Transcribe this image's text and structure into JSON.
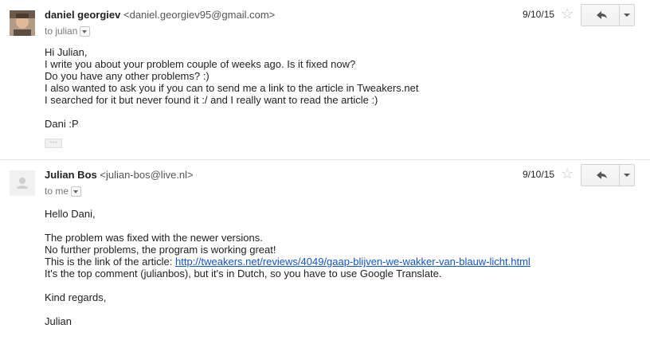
{
  "messages": [
    {
      "sender_name": "daniel georgiev",
      "sender_email": "<daniel.georgiev95@gmail.com>",
      "to_line": "to julian",
      "date": "9/10/15",
      "body": {
        "l1": "Hi Julian,",
        "l2": "I write you about your problem couple of weeks ago. Is it fixed now?",
        "l3": "Do you have any other problems? :)",
        "l4": "I also wanted to ask you if you can to send me a link to the article in Tweakers.net",
        "l5": "I searched for it but never found it :/ and I really want to read the article :)",
        "l6": "Dani :P"
      },
      "ellipsis": "···"
    },
    {
      "sender_name": "Julian Bos",
      "sender_email": "<julian-bos@live.nl>",
      "to_line": "to me",
      "date": "9/10/15",
      "body": {
        "l1": "Hello Dani,",
        "l2": "The problem was fixed with the newer versions.",
        "l3": "No further problems, the program is working great!",
        "l4_prefix": "This is the link of the article: ",
        "l4_link": "http://tweakers.net/reviews/4049/gaap-blijven-we-wakker-van-blauw-licht.html",
        "l5": "It's the top comment (julianbos), but it's in Dutch, so you have to use Google Translate.",
        "l6": "Kind regards,",
        "l7": "Julian"
      }
    }
  ],
  "icons": {
    "star": "☆",
    "reply": "reply-arrow",
    "more": "dropdown-arrow"
  }
}
